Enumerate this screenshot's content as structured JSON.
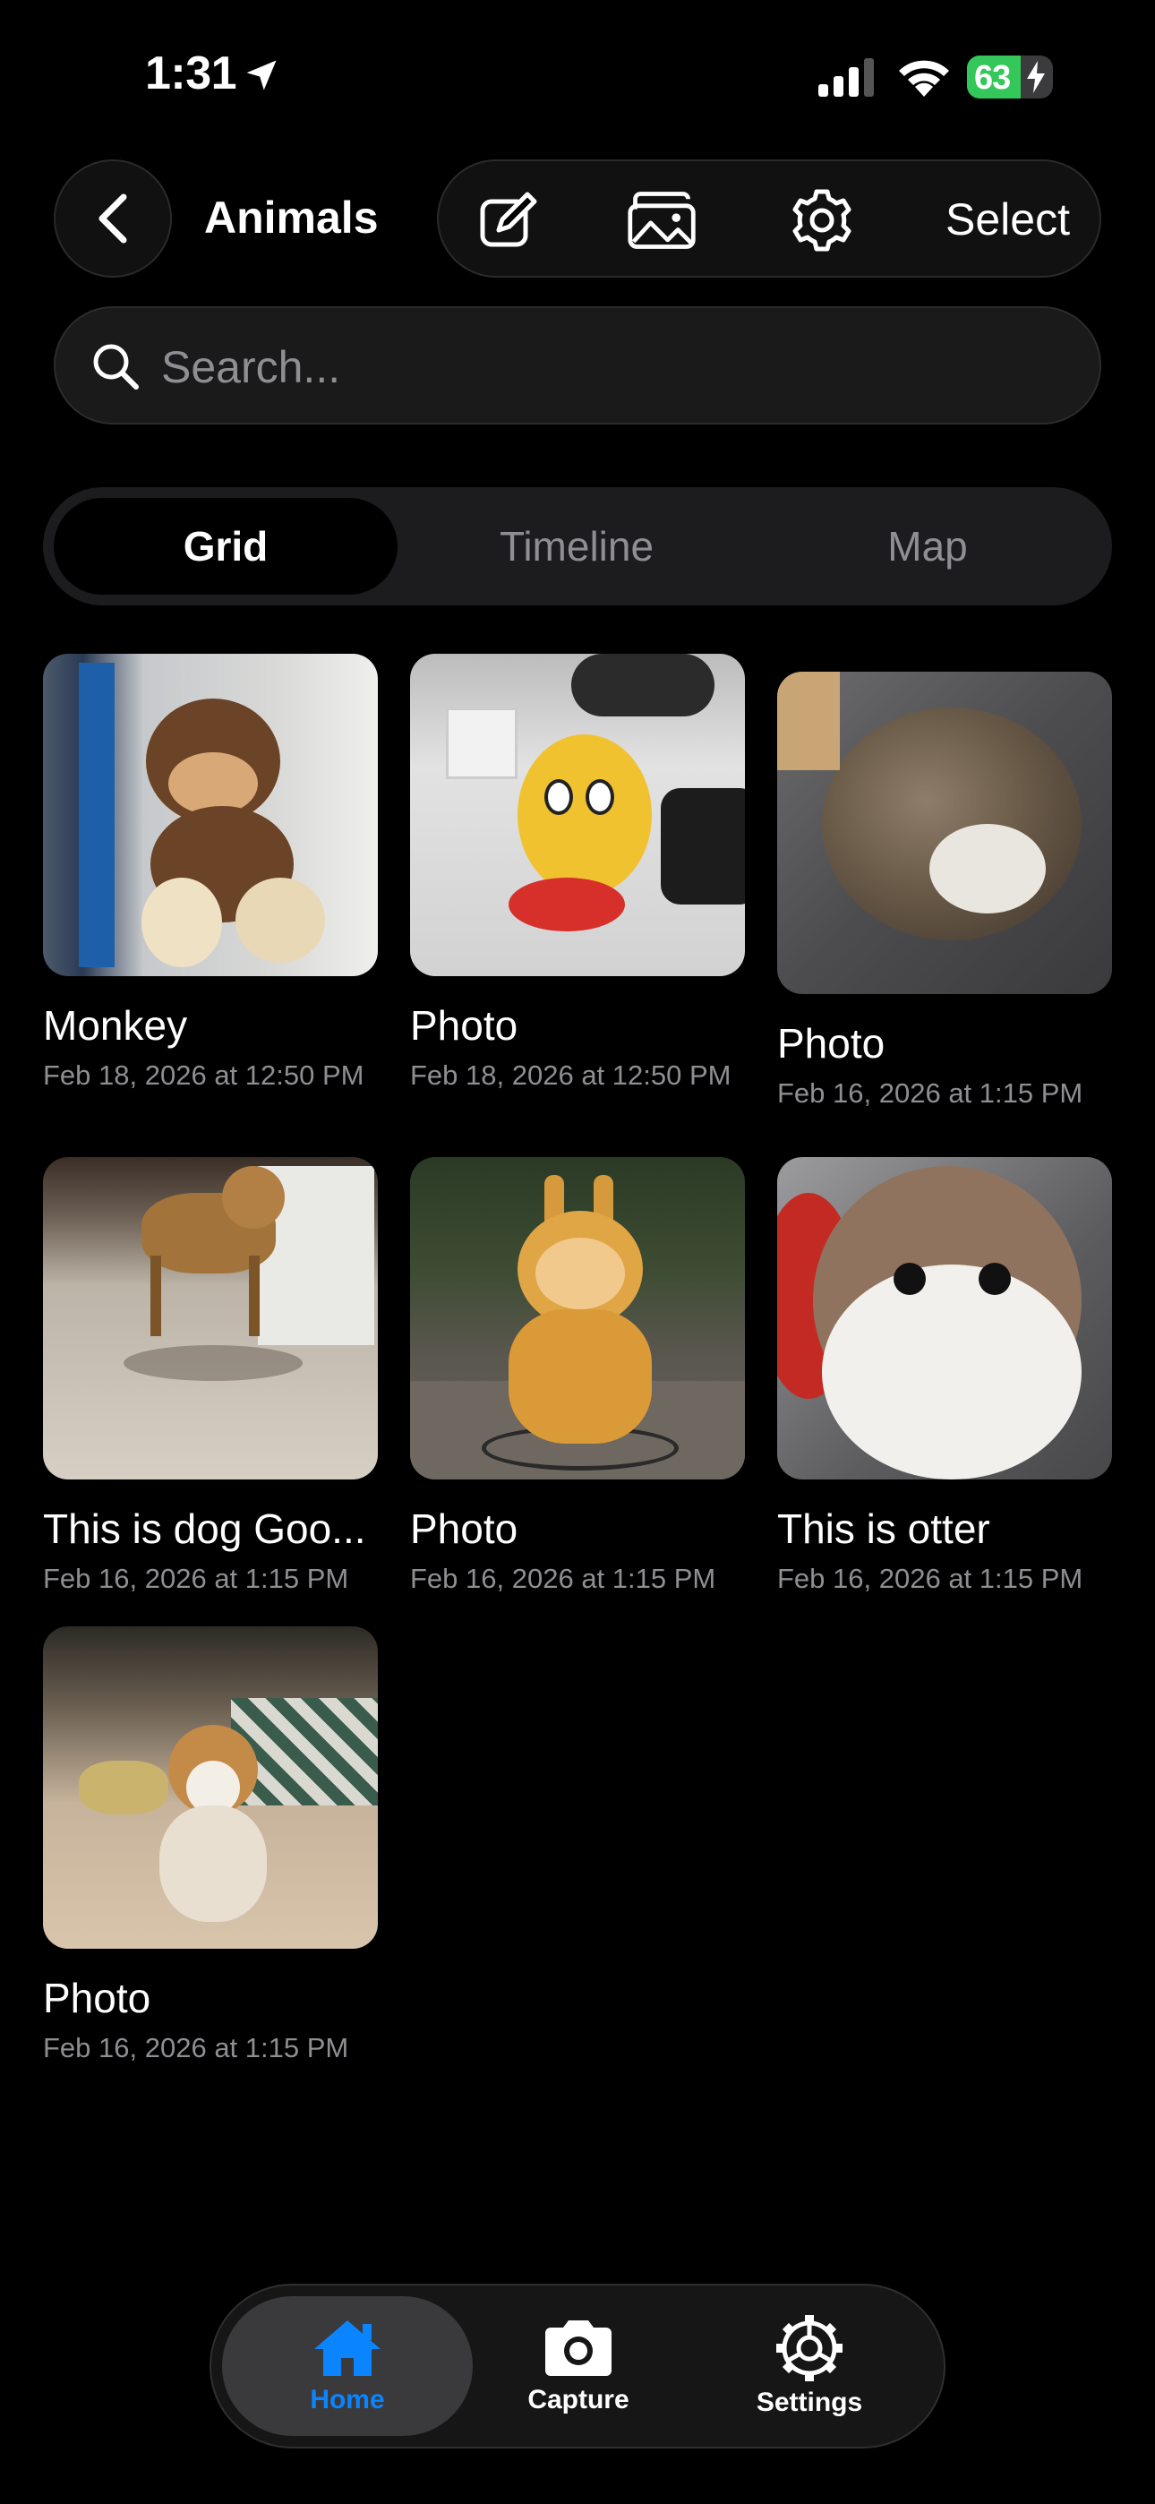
{
  "status_bar": {
    "time": "1:31",
    "battery": "63",
    "battery_level": 0.63
  },
  "header": {
    "title": "Animals",
    "select_label": "Select"
  },
  "search": {
    "placeholder": "Search..."
  },
  "view_tabs": [
    {
      "label": "Grid",
      "active": true
    },
    {
      "label": "Timeline",
      "active": false
    },
    {
      "label": "Map",
      "active": false
    }
  ],
  "items": [
    {
      "name": "Monkey",
      "date": "Feb 18, 2026 at 12:50 PM"
    },
    {
      "name": "Photo",
      "date": "Feb 18, 2026 at 12:50 PM"
    },
    {
      "name": "Photo",
      "date": "Feb 16, 2026 at 1:15 PM"
    },
    {
      "name": "This is dog Goo...",
      "date": "Feb 16, 2026 at 1:15 PM"
    },
    {
      "name": "Photo",
      "date": "Feb 16, 2026 at 1:15 PM"
    },
    {
      "name": "This is otter",
      "date": "Feb 16, 2026 at 1:15 PM"
    },
    {
      "name": "Photo",
      "date": "Feb 16, 2026 at 1:15 PM"
    }
  ],
  "tabbar": [
    {
      "label": "Home",
      "icon": "house-icon",
      "active": true
    },
    {
      "label": "Capture",
      "icon": "camera-icon",
      "active": false
    },
    {
      "label": "Settings",
      "icon": "gear-icon",
      "active": false
    }
  ],
  "colors": {
    "accent": "#0a84ff",
    "battery_green": "#34c759",
    "background": "#000000",
    "secondary_text": "#8e8e93"
  }
}
